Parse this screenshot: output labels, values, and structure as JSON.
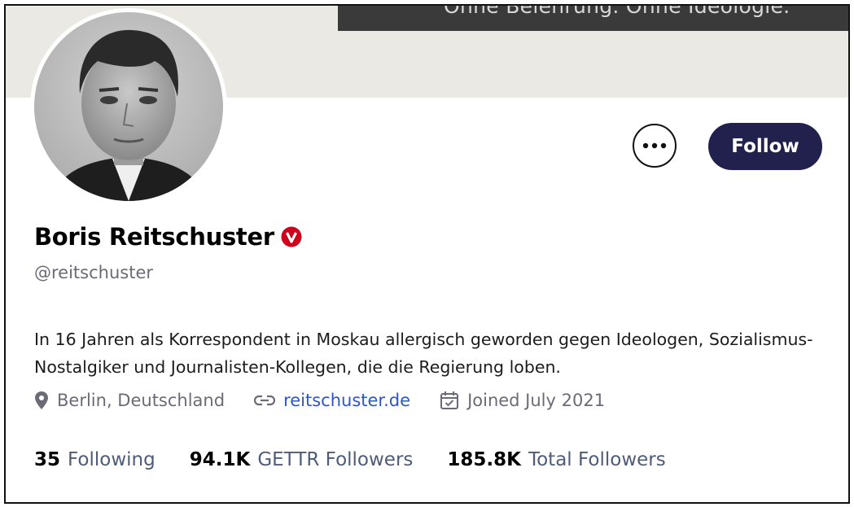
{
  "cover": {
    "banner_text": "Ohne Belehrung. Ohne Ideologie."
  },
  "profile": {
    "display_name": "Boris Reitschuster",
    "handle": "@reitschuster",
    "verified_badge_icon": "verified-v-badge",
    "verified_color": "#d0021b",
    "bio": "In 16 Jahren als Korrespondent in Moskau allergisch geworden gegen Ideologen, Sozialismus-Nostalgiker und Journalisten-Kollegen, die die Regierung loben."
  },
  "actions": {
    "more_icon": "ellipsis-icon",
    "follow_label": "Follow",
    "follow_color": "#22214e"
  },
  "meta": {
    "location_icon": "map-pin-icon",
    "location": "Berlin, Deutschland",
    "link_icon": "link-icon",
    "website": "reitschuster.de",
    "website_color": "#2f56c8",
    "calendar_icon": "calendar-icon",
    "joined": "Joined July 2021"
  },
  "stats": [
    {
      "count": "35",
      "label": "Following"
    },
    {
      "count": "94.1K",
      "label": "GETTR Followers"
    },
    {
      "count": "185.8K",
      "label": "Total Followers"
    }
  ]
}
